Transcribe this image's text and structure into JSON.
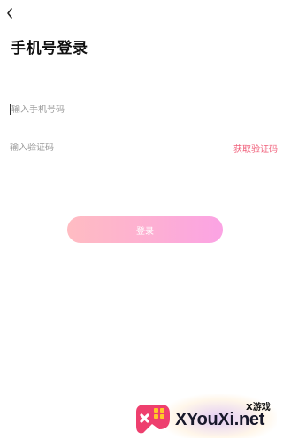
{
  "nav": {
    "back_icon": "chevron-left-icon"
  },
  "page": {
    "title": "手机号登录"
  },
  "phone": {
    "placeholder": "输入手机号码"
  },
  "code": {
    "placeholder": "输入验证码",
    "get_code_label": "获取验证码",
    "link_color": "#f0607b"
  },
  "login": {
    "label": "登录",
    "gradient": [
      "#ffbcc2",
      "#fba3e4"
    ]
  },
  "watermark": {
    "text": "XYouXi.net",
    "subtext": "X游戏",
    "logo_icon": "gamepad-logo-icon"
  }
}
